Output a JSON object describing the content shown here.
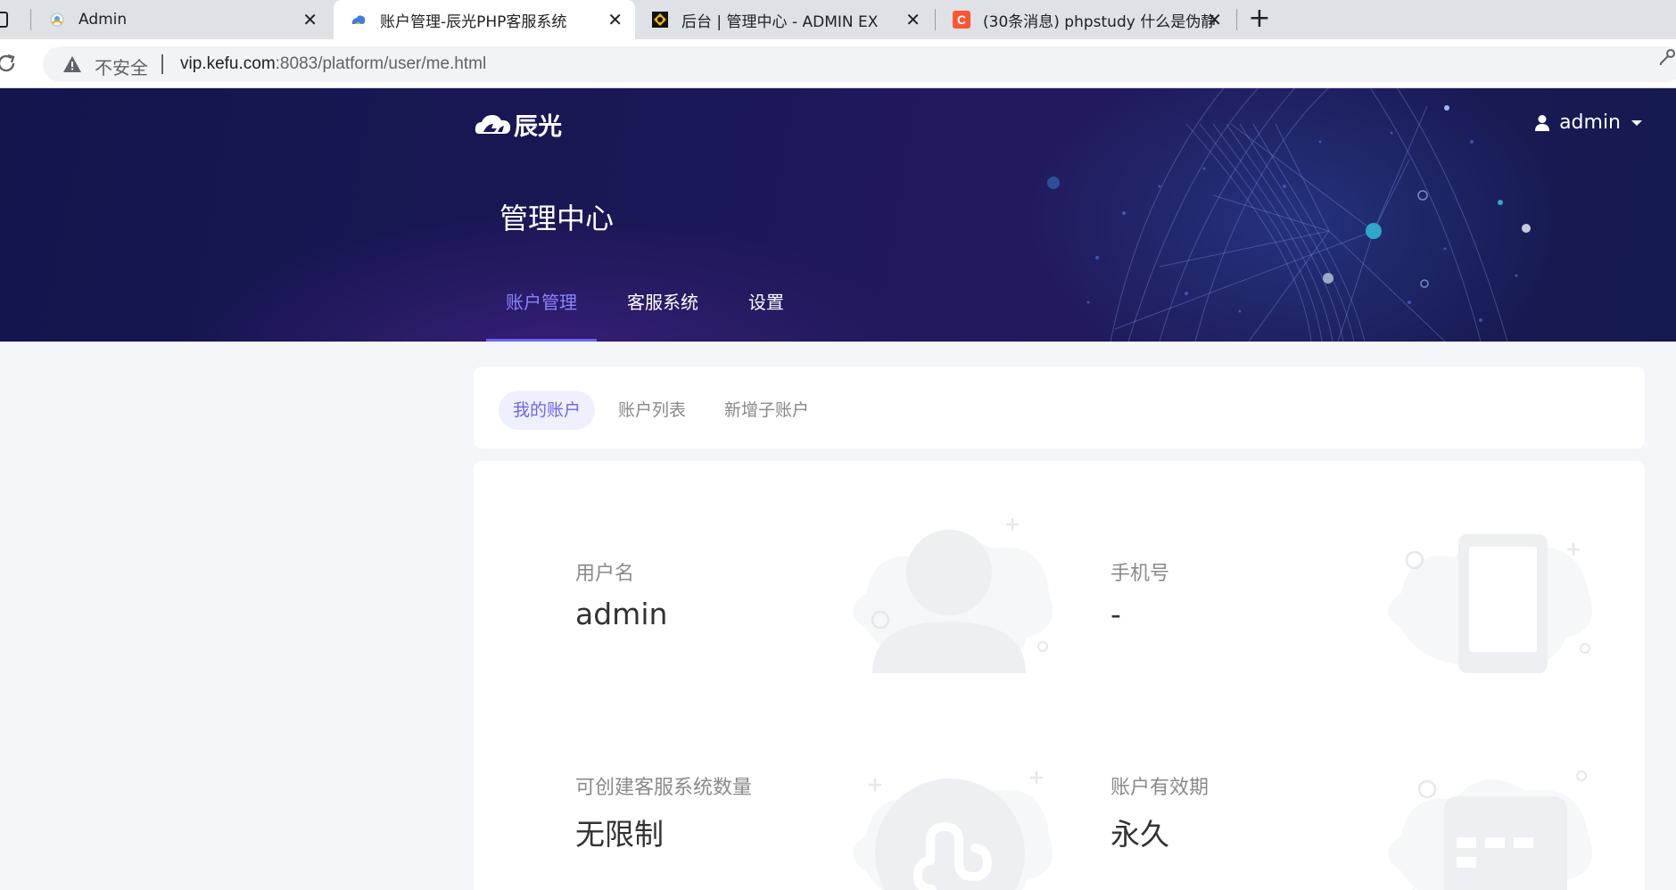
{
  "browser": {
    "tabs": [
      {
        "title": "Admin",
        "active": false
      },
      {
        "title": "账户管理-辰光PHP客服系统",
        "active": true
      },
      {
        "title": "后台 | 管理中心 - ADMIN EX",
        "active": false
      },
      {
        "title": "(30条消息) phpstudy 什么是伪静",
        "active": false
      }
    ],
    "address": {
      "security_label": "不安全",
      "host": "vip.kefu.com",
      "path": ":8083/platform/user/me.html"
    }
  },
  "header": {
    "brand": "辰光",
    "user": "admin",
    "page_title": "管理中心",
    "nav": [
      {
        "label": "账户管理",
        "active": true
      },
      {
        "label": "客服系统",
        "active": false
      },
      {
        "label": "设置",
        "active": false
      }
    ]
  },
  "subtabs": [
    {
      "label": "我的账户",
      "active": true
    },
    {
      "label": "账户列表",
      "active": false
    },
    {
      "label": "新增子账户",
      "active": false
    }
  ],
  "account_info": [
    {
      "label": "用户名",
      "value": "admin",
      "icon": "user-icon"
    },
    {
      "label": "手机号",
      "value": "-",
      "icon": "phone-icon"
    },
    {
      "label": "可创建客服系统数量",
      "value": "无限制",
      "icon": "mini-program-icon"
    },
    {
      "label": "账户有效期",
      "value": "永久",
      "icon": "calendar-icon"
    }
  ],
  "colors": {
    "accent": "#6c64f5",
    "hero_bg": "#1a1856",
    "page_bg": "#f4f6f9"
  }
}
